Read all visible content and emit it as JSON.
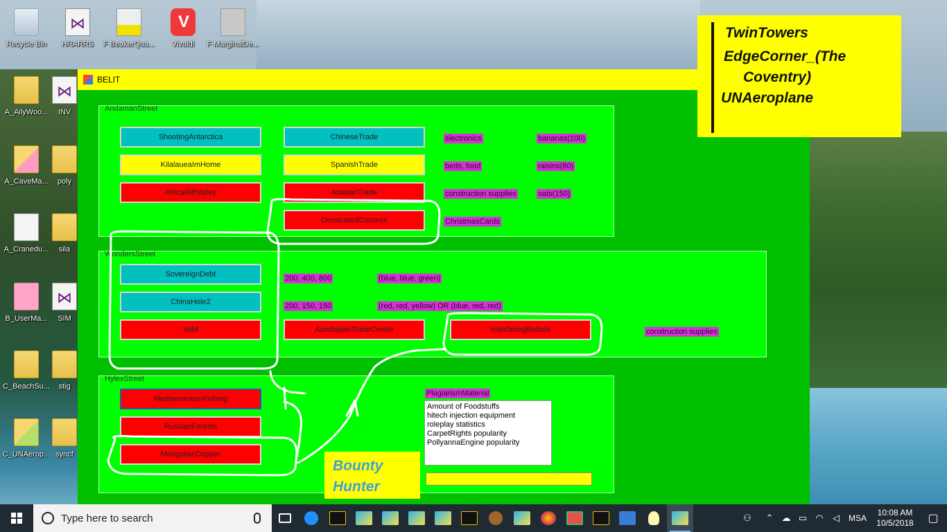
{
  "window": {
    "title": "BELIT"
  },
  "desktop_icons": [
    {
      "label": "Recycle Bin",
      "icon": "recycle-bin-icon"
    },
    {
      "label": "HRARRS",
      "icon": "visual-studio-icon"
    },
    {
      "label": "F BeakerQua...",
      "icon": "document-icon"
    },
    {
      "label": "Vivaldi",
      "icon": "vivaldi-icon"
    },
    {
      "label": "F MarginalDe...",
      "icon": "document-icon"
    },
    {
      "label": "A_AilyWoo...",
      "icon": "folder-icon"
    },
    {
      "label": "INV",
      "icon": "visual-studio-icon"
    },
    {
      "label": "A_CaveMa...",
      "icon": "folder-icon"
    },
    {
      "label": "poly",
      "icon": "folder-icon"
    },
    {
      "label": "A_Cranedu...",
      "icon": "document-icon"
    },
    {
      "label": "sila",
      "icon": "folder-icon"
    },
    {
      "label": "B_UserMa...",
      "icon": "folder-icon"
    },
    {
      "label": "SIM",
      "icon": "visual-studio-icon"
    },
    {
      "label": "C_BeachSu...",
      "icon": "folder-icon"
    },
    {
      "label": "stig",
      "icon": "folder-icon"
    },
    {
      "label": "C_UNAerop...",
      "icon": "folder-icon"
    },
    {
      "label": "syncf",
      "icon": "folder-icon"
    }
  ],
  "groups": {
    "andaman": {
      "label": "AndamanStreet",
      "buttons": [
        "ShootingAntarctica",
        "KilalaueaImHome",
        "AfricaRiftValley",
        "ChineseTrade",
        "SpanishTrade",
        "ArabianTrade",
        "DessicatedCoconut"
      ],
      "tags": [
        "electronics",
        "beds, food",
        "construction supplies",
        "ChristmasCards",
        "bananas(100)",
        "raisins(80)",
        "oats(150)"
      ]
    },
    "wonders": {
      "label": "WondersStreet",
      "buttons": [
        "SovereignDebt",
        "ChinaHole2",
        "VaM",
        "AzerbaijanTradeCentre",
        "InterfacingRobots"
      ],
      "tags": [
        "200, 400, 800",
        "200, 150, 150",
        "(blue, blue, green)",
        "(red, red, yellow) OR (blue, red, red)",
        "construction supplies"
      ]
    },
    "hylex": {
      "label": "HylexStreet",
      "buttons": [
        "MediterraneanFishing",
        "RussianForests",
        "MongolianCopper"
      ],
      "tag": "PlagiarismMaterial",
      "list": [
        "Amount of Foodstuffs",
        "hitech injection equipment",
        "roleplay statistics",
        "CarpetRights popularity",
        "PollyannaEngine popularity"
      ]
    }
  },
  "bounty": {
    "line1": "Bounty",
    "line2": "Hunter"
  },
  "notes": {
    "line1": "TwinTowers",
    "line2": "EdgeCorner_(The",
    "line3": "Coventry)",
    "line4": "UNAeroplane"
  },
  "taskbar": {
    "search_placeholder": "Type here to search",
    "lang": "MSA",
    "time": "10:08 AM",
    "date": "10/5/2018"
  },
  "colors": {
    "window_bg": "#00c000",
    "group_bg": "#00ff00",
    "accent_yellow": "#ffff00",
    "tag_magenta": "#d631d6"
  }
}
